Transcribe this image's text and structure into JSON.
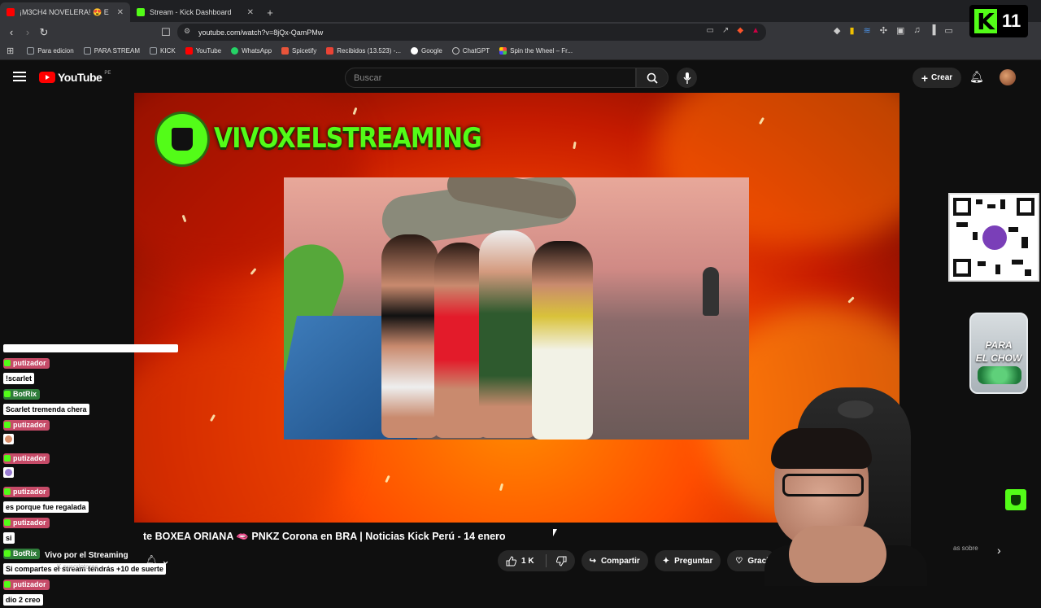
{
  "browser": {
    "tabs": [
      {
        "title": "¡M3CH4 NOVELERA! 😍 E",
        "favicon_color": "#ff0000",
        "active": true
      },
      {
        "title": "Stream - Kick Dashboard",
        "favicon_color": "#53fc18",
        "active": false
      }
    ],
    "url": "youtube.com/watch?v=8jQx-QamPMw",
    "bookmarks": [
      {
        "label": "Para edicion",
        "icon": "folder-icon",
        "color": "#9aa0a6"
      },
      {
        "label": "PARA STREAM",
        "icon": "folder-icon",
        "color": "#9aa0a6"
      },
      {
        "label": "KICK",
        "icon": "folder-icon",
        "color": "#9aa0a6"
      },
      {
        "label": "YouTube",
        "icon": "youtube-icon",
        "color": "#ff0000"
      },
      {
        "label": "WhatsApp",
        "icon": "whatsapp-icon",
        "color": "#25d366"
      },
      {
        "label": "Spicetify",
        "icon": "spicetify-icon",
        "color": "#e8543a"
      },
      {
        "label": "Recibidos (13.523) -...",
        "icon": "gmail-icon",
        "color": "#ea4335"
      },
      {
        "label": "Google",
        "icon": "google-icon",
        "color": "#4285f4"
      },
      {
        "label": "ChatGPT",
        "icon": "chatgpt-icon",
        "color": "#cccccc"
      },
      {
        "label": "Spin the Wheel – Fr...",
        "icon": "wheel-icon",
        "color": "#f4b400"
      }
    ]
  },
  "kick_badge": {
    "count": "11"
  },
  "youtube": {
    "logo_text": "YouTube",
    "region": "PE",
    "search_placeholder": "Buscar",
    "create_label": "Crear"
  },
  "video": {
    "channel_banner": "VIVOXELSTREAMING",
    "title": "te BOXEA ORIANA 🫦 PNKZ Corona en BRA | Noticias Kick Perú - 14 enero",
    "channel_name": "Vivo por el Streaming",
    "subscribers": "K suscriptores",
    "likes": "1 K",
    "share_label": "Compartir",
    "ask_label": "Preguntar",
    "thanks_label": "Graci",
    "side_text": "as sobre"
  },
  "overlay": {
    "jar_label_1": "PARA",
    "jar_label_2": "EL CHOW"
  },
  "chat": [
    {
      "user": "putizador",
      "bot": false,
      "message": "!scarlet",
      "emote": null
    },
    {
      "user": "BotRix",
      "bot": true,
      "message": "Scarlet tremenda chera",
      "emote": null
    },
    {
      "user": "putizador",
      "bot": false,
      "message": null,
      "emote": "#d98f6b"
    },
    {
      "user": "putizador",
      "bot": false,
      "message": null,
      "emote": "#9b7fd4"
    },
    {
      "user": "putizador",
      "bot": false,
      "message": "es porque fue regalada",
      "emote": null
    },
    {
      "user": "putizador",
      "bot": false,
      "message": "si",
      "emote": null
    },
    {
      "user": "BotRix",
      "bot": true,
      "message": "Si compartes el stream tendrás +10 de suerte",
      "emote": null
    },
    {
      "user": "putizador",
      "bot": false,
      "message": "dio 2 creo",
      "emote": null
    }
  ]
}
